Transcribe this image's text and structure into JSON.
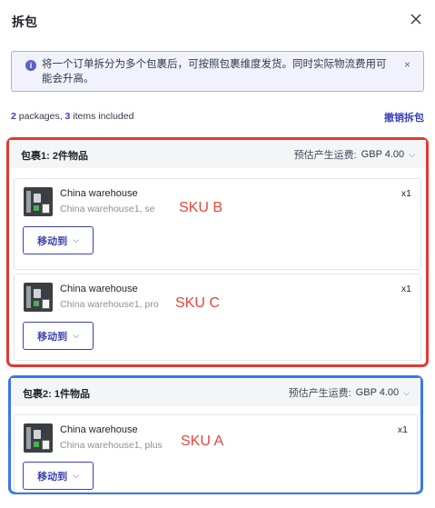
{
  "dialog": {
    "title": "拆包",
    "notice": "将一个订单拆分为多个包裹后，可按照包裹维度发货。同时实际物流费用可能会升高。",
    "notice_close": "×",
    "info_glyph": "i"
  },
  "summary": {
    "packages_count": "2",
    "packages_text": " packages, ",
    "items_count": "3",
    "items_text": " items included",
    "undo_label": "撤销拆包"
  },
  "packages": [
    {
      "title": "包裹1: 2件物品",
      "fee_label": "预估产生运费:",
      "fee_amount": "GBP 4.00",
      "border_color": "#e03a33",
      "items": [
        {
          "name": "China warehouse",
          "sub": "China warehouse1, se",
          "qty": "x1",
          "sku": "SKU B",
          "move_label": "移动到"
        },
        {
          "name": "China warehouse",
          "sub": "China warehouse1, pro",
          "qty": "x1",
          "sku": "SKU C",
          "move_label": "移动到"
        }
      ]
    },
    {
      "title": "包裹2: 1件物品",
      "fee_label": "预估产生运费:",
      "fee_amount": "GBP 4.00",
      "border_color": "#3b79e6",
      "items": [
        {
          "name": "China warehouse",
          "sub": "China warehouse1, plus",
          "qty": "x1",
          "sku": "SKU A",
          "move_label": "移动到"
        }
      ]
    }
  ],
  "icons": {
    "close": "close-icon",
    "info": "info-icon",
    "chevron": "chevron-down-icon",
    "product": "product-thumbnail"
  },
  "colors": {
    "accent": "#3b41b5",
    "package1_highlight": "#e03a33",
    "package2_highlight": "#3b79e6",
    "sku_annotation": "#e8453c"
  }
}
